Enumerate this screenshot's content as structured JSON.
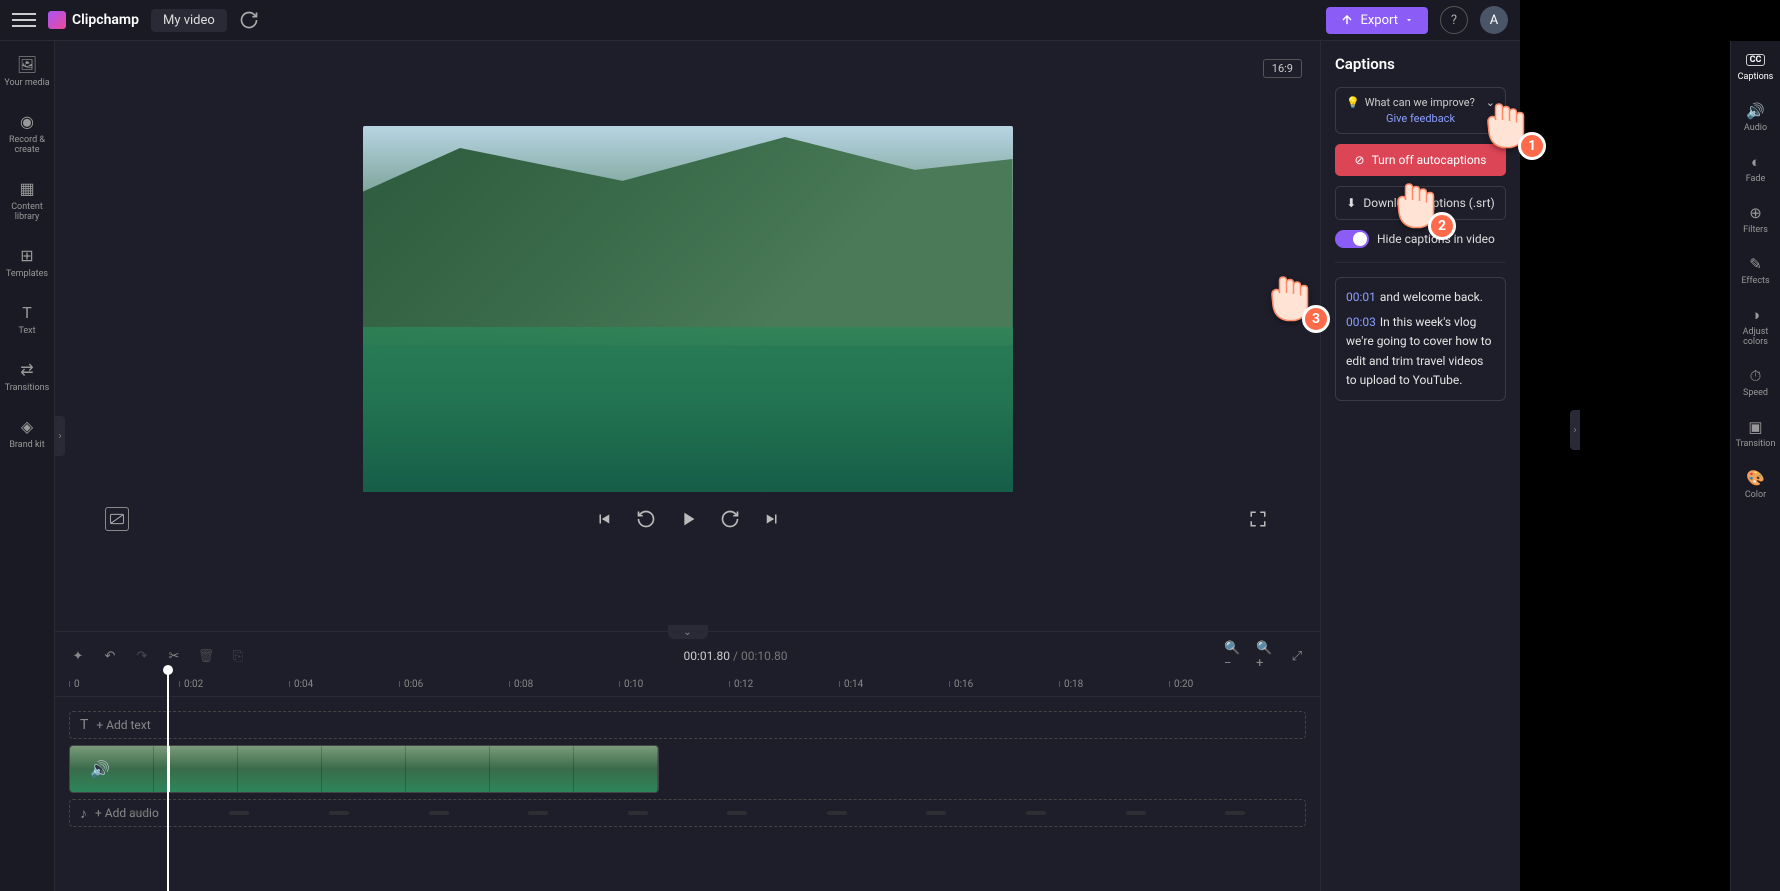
{
  "header": {
    "app_name": "Clipchamp",
    "video_title": "My video",
    "export_label": "Export",
    "avatar_letter": "A"
  },
  "left_rail": [
    {
      "label": "Your media",
      "icon": "🖼"
    },
    {
      "label": "Record & create",
      "icon": "◉"
    },
    {
      "label": "Content library",
      "icon": "▦"
    },
    {
      "label": "Templates",
      "icon": "⊞"
    },
    {
      "label": "Text",
      "icon": "T"
    },
    {
      "label": "Transitions",
      "icon": "⇄"
    },
    {
      "label": "Brand kit",
      "icon": "◈"
    }
  ],
  "preview": {
    "aspect": "16:9"
  },
  "player": {
    "cc_off": "⊘cc"
  },
  "timeline": {
    "current": "00:01.80",
    "total": "00:10.80",
    "marks": [
      "0",
      "0:02",
      "0:04",
      "0:06",
      "0:08",
      "0:10",
      "0:12",
      "0:14",
      "0:16",
      "0:18",
      "0:20"
    ],
    "add_text": "+ Add text",
    "add_audio": "+ Add audio"
  },
  "captions_panel": {
    "title": "Captions",
    "feedback_q": "What can we improve?",
    "feedback_link": "Give feedback",
    "turn_off": "Turn off autocaptions",
    "download": "Download captions (.srt)",
    "hide_toggle": "Hide captions in video",
    "transcript": [
      {
        "ts": "00:01",
        "text": "and welcome back."
      },
      {
        "ts": "00:03",
        "text": "In this week's vlog we're going to cover how to edit and trim travel videos to upload to YouTube."
      }
    ]
  },
  "right_rail": [
    {
      "label": "Captions",
      "icon": "CC",
      "active": true
    },
    {
      "label": "Audio",
      "icon": "♪"
    },
    {
      "label": "Fade",
      "icon": "◐"
    },
    {
      "label": "Filters",
      "icon": "⊕"
    },
    {
      "label": "Effects",
      "icon": "✦"
    },
    {
      "label": "Adjust colors",
      "icon": "◑"
    },
    {
      "label": "Speed",
      "icon": "⏱"
    },
    {
      "label": "Transition",
      "icon": "▣"
    },
    {
      "label": "Color",
      "icon": "🎨"
    }
  ],
  "pointers": {
    "p1": "1",
    "p2": "2",
    "p3": "3"
  }
}
